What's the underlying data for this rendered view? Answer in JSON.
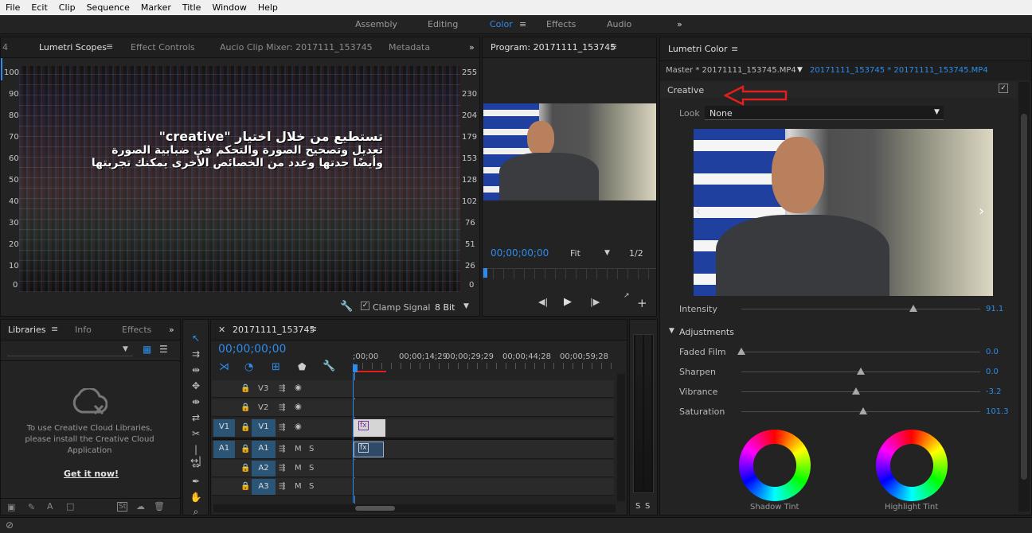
{
  "menu": [
    "File",
    "Ecit",
    "Clip",
    "Sequence",
    "Marker",
    "Title",
    "Window",
    "Help"
  ],
  "workspaces": [
    "Assembly",
    "Editing",
    "Color",
    "Effects",
    "Audio"
  ],
  "workspace_more": "»",
  "scopes": {
    "tabs": [
      "4",
      "Lumetri Scopes",
      "Effect Controls",
      "Aucio Clip Mixer: 2017111_153745",
      "Metadata"
    ],
    "more": "»",
    "left_scale": [
      "100",
      "90",
      "80",
      "70",
      "60",
      "50",
      "40",
      "30",
      "20",
      "10",
      "0"
    ],
    "right_scale": [
      "255",
      "230",
      "204",
      "179",
      "153",
      "128",
      "102",
      "76",
      "51",
      "26",
      "0"
    ],
    "clamp_label": "Clamp Signal",
    "bit_depth": "8 Bit"
  },
  "overlay": {
    "line1": "تستطيع من خلال اختيار \"creative\"",
    "line2": "تعديل وتصحيح الصورة  والتحكم في ضبابية الصورة",
    "line3": "وأيضًا حدتها وعدد من الخصائص الأخرى يمكنك تجربتها"
  },
  "program": {
    "title": "Program: 20171111_153745",
    "timecode": "00;00;00;00",
    "fit": "Fit",
    "resolution": "1/2"
  },
  "lumetri": {
    "title": "Lumetri Color",
    "master": "Master * 20171111_153745.MP4",
    "clip": "20171111_153745 * 20171111_153745.MP4",
    "creative": "Creative",
    "look_label": "Look",
    "look_value": "None",
    "intensity_label": "Intensity",
    "intensity_value": "91.1",
    "adjustments": "Adjustments",
    "faded_film": "Faded Film",
    "faded_film_value": "0.0",
    "sharpen": "Sharpen",
    "sharpen_value": "0.0",
    "vibrance": "Vibrance",
    "vibrance_value": "-3.2",
    "saturation": "Saturation",
    "saturation_value": "101.3",
    "shadow_tint": "Shadow Tint",
    "highlight_tint": "Highlight Tint",
    "levels": {
      "intensity": 0.72,
      "faded_film": 0.0,
      "sharpen": 0.5,
      "vibrance": 0.48,
      "saturation": 0.51
    }
  },
  "libraries": {
    "tabs": [
      "Libraries",
      "Info",
      "Effects"
    ],
    "more": "»",
    "message": "To use Creative Cloud Libraries, please install the Creative Cloud Application",
    "link": "Get it now!"
  },
  "timeline": {
    "sequence": "20171111_153745",
    "timecode": "00;00;00;00",
    "ruler": [
      ";00;00",
      "00;00;14;29",
      "00;00;29;29",
      "00;00;44;28",
      "00;00;59;28"
    ],
    "video_tracks": [
      "V3",
      "V2",
      "V1"
    ],
    "audio_tracks": [
      "A1",
      "A2",
      "A3"
    ],
    "source_v": "V1",
    "source_a": "A1",
    "m": "M",
    "s": "S",
    "clip_label": "fx"
  },
  "audio_meter": {
    "left": "S",
    "right": "S"
  },
  "colors": {
    "accent": "#2d8ceb",
    "arrow": "#e0201c"
  }
}
